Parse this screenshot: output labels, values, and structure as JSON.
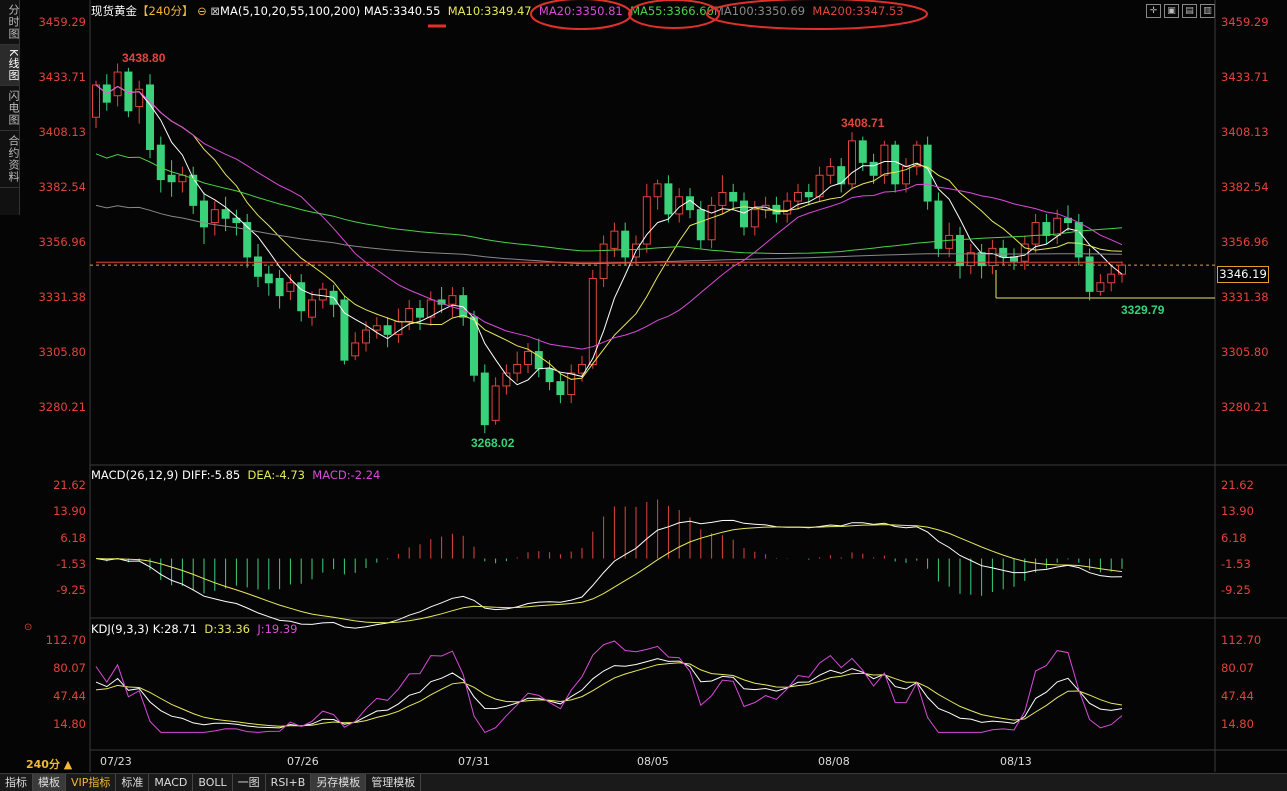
{
  "left_tabs": [
    "分时图",
    "K线图",
    "闪电图",
    "合约资料"
  ],
  "main": {
    "symbol": "现货黄金",
    "period_tag": "【240分】",
    "ma_params": "MA(5,10,20,55,100,200)",
    "ma5": "MA5:3340.55",
    "ma10": "MA10:3349.47",
    "ma20": "MA20:3350.81",
    "ma55": "MA55:3366.60",
    "ma100": "MA100:3350.69",
    "ma200": "MA200:3347.53",
    "price_ticks": [
      "3459.29",
      "3433.71",
      "3408.13",
      "3382.54",
      "3356.96",
      "3331.38",
      "3305.80",
      "3280.21"
    ],
    "current_price": "3346.19",
    "high_label": "3438.80",
    "mid_high_label": "3408.71",
    "low_label": "3268.02",
    "recent_low_label": "3329.79"
  },
  "macd": {
    "title": "MACD(26,12,9)",
    "diff": "DIFF:-5.85",
    "dea": "DEA:-4.73",
    "macd": "MACD:-2.24",
    "ticks": [
      "21.62",
      "13.90",
      "6.18",
      "-1.53",
      "-9.25"
    ]
  },
  "kdj": {
    "title": "KDJ(9,3,3)",
    "k": "K:28.71",
    "d": "D:33.36",
    "j": "J:19.39",
    "ticks": [
      "112.70",
      "80.07",
      "47.44",
      "14.80"
    ]
  },
  "dates": [
    "07/23",
    "07/26",
    "07/31",
    "08/05",
    "08/08",
    "08/13"
  ],
  "period_selector": "240分 ▲",
  "bottom_tabs": [
    "指标",
    "模板",
    "VIP指标",
    "标准",
    "MACD",
    "BOLL",
    "一图",
    "RSI+B",
    "另存模板",
    "管理模板"
  ],
  "colors": {
    "up": "#e0443c",
    "down": "#3ad17a",
    "ma5": "#ffffff",
    "ma10": "#e8e85a",
    "ma20": "#d94bd9",
    "ma55": "#4bd14b",
    "ma100": "#888888",
    "ma200": "#e0443c",
    "annotation": "#e0302a"
  },
  "chart_data": {
    "type": "candlestick",
    "price_ylim": [
      3260,
      3465
    ],
    "candles": [
      [
        3415,
        3430,
        3432,
        3410
      ],
      [
        3430,
        3422,
        3435,
        3418
      ],
      [
        3425,
        3436,
        3440,
        3420
      ],
      [
        3436,
        3418,
        3438,
        3415
      ],
      [
        3420,
        3428,
        3432,
        3412
      ],
      [
        3430,
        3400,
        3435,
        3396
      ],
      [
        3402,
        3386,
        3406,
        3380
      ],
      [
        3388,
        3385,
        3395,
        3378
      ],
      [
        3385,
        3388,
        3392,
        3380
      ],
      [
        3388,
        3374,
        3392,
        3370
      ],
      [
        3376,
        3364,
        3380,
        3356
      ],
      [
        3366,
        3372,
        3376,
        3360
      ],
      [
        3372,
        3368,
        3378,
        3362
      ],
      [
        3368,
        3366,
        3372,
        3360
      ],
      [
        3366,
        3350,
        3370,
        3345
      ],
      [
        3350,
        3341,
        3356,
        3336
      ],
      [
        3342,
        3338,
        3346,
        3332
      ],
      [
        3340,
        3332,
        3344,
        3326
      ],
      [
        3334,
        3338,
        3342,
        3330
      ],
      [
        3338,
        3325,
        3342,
        3320
      ],
      [
        3322,
        3330,
        3334,
        3318
      ],
      [
        3330,
        3335,
        3338,
        3326
      ],
      [
        3334,
        3328,
        3337,
        3322
      ],
      [
        3330,
        3302,
        3332,
        3300
      ],
      [
        3304,
        3310,
        3315,
        3302
      ],
      [
        3310,
        3316,
        3320,
        3306
      ],
      [
        3316,
        3318,
        3322,
        3312
      ],
      [
        3318,
        3314,
        3322,
        3308
      ],
      [
        3314,
        3320,
        3326,
        3310
      ],
      [
        3320,
        3326,
        3330,
        3316
      ],
      [
        3326,
        3322,
        3330,
        3316
      ],
      [
        3322,
        3330,
        3334,
        3318
      ],
      [
        3330,
        3328,
        3336,
        3324
      ],
      [
        3328,
        3332,
        3336,
        3322
      ],
      [
        3332,
        3322,
        3336,
        3318
      ],
      [
        3322,
        3295,
        3325,
        3292
      ],
      [
        3296,
        3272,
        3300,
        3268
      ],
      [
        3274,
        3290,
        3294,
        3272
      ],
      [
        3290,
        3296,
        3300,
        3286
      ],
      [
        3296,
        3300,
        3306,
        3292
      ],
      [
        3300,
        3306,
        3310,
        3296
      ],
      [
        3306,
        3298,
        3312,
        3294
      ],
      [
        3298,
        3292,
        3302,
        3288
      ],
      [
        3292,
        3286,
        3296,
        3282
      ],
      [
        3286,
        3296,
        3300,
        3282
      ],
      [
        3296,
        3300,
        3304,
        3292
      ],
      [
        3300,
        3340,
        3344,
        3298
      ],
      [
        3340,
        3356,
        3360,
        3336
      ],
      [
        3354,
        3362,
        3366,
        3350
      ],
      [
        3362,
        3350,
        3366,
        3346
      ],
      [
        3350,
        3356,
        3360,
        3346
      ],
      [
        3356,
        3378,
        3384,
        3352
      ],
      [
        3378,
        3384,
        3386,
        3372
      ],
      [
        3384,
        3370,
        3388,
        3366
      ],
      [
        3370,
        3378,
        3382,
        3366
      ],
      [
        3378,
        3372,
        3382,
        3368
      ],
      [
        3372,
        3358,
        3376,
        3354
      ],
      [
        3358,
        3374,
        3378,
        3354
      ],
      [
        3374,
        3380,
        3388,
        3370
      ],
      [
        3380,
        3376,
        3384,
        3372
      ],
      [
        3376,
        3364,
        3380,
        3360
      ],
      [
        3364,
        3372,
        3376,
        3360
      ],
      [
        3372,
        3374,
        3378,
        3368
      ],
      [
        3374,
        3370,
        3378,
        3366
      ],
      [
        3370,
        3376,
        3380,
        3366
      ],
      [
        3376,
        3380,
        3384,
        3372
      ],
      [
        3380,
        3378,
        3384,
        3374
      ],
      [
        3378,
        3388,
        3392,
        3376
      ],
      [
        3388,
        3392,
        3396,
        3384
      ],
      [
        3392,
        3384,
        3396,
        3380
      ],
      [
        3384,
        3404,
        3408,
        3382
      ],
      [
        3404,
        3394,
        3406,
        3390
      ],
      [
        3394,
        3388,
        3398,
        3384
      ],
      [
        3388,
        3402,
        3404,
        3384
      ],
      [
        3402,
        3384,
        3404,
        3380
      ],
      [
        3384,
        3392,
        3396,
        3380
      ],
      [
        3392,
        3402,
        3404,
        3388
      ],
      [
        3402,
        3376,
        3406,
        3372
      ],
      [
        3376,
        3354,
        3380,
        3350
      ],
      [
        3354,
        3360,
        3366,
        3350
      ],
      [
        3360,
        3346,
        3364,
        3340
      ],
      [
        3346,
        3352,
        3356,
        3342
      ],
      [
        3352,
        3346,
        3356,
        3340
      ],
      [
        3346,
        3354,
        3358,
        3342
      ],
      [
        3354,
        3350,
        3358,
        3346
      ],
      [
        3350,
        3348,
        3354,
        3344
      ],
      [
        3348,
        3356,
        3360,
        3344
      ],
      [
        3356,
        3366,
        3370,
        3352
      ],
      [
        3366,
        3360,
        3370,
        3356
      ],
      [
        3360,
        3368,
        3372,
        3356
      ],
      [
        3368,
        3366,
        3374,
        3362
      ],
      [
        3366,
        3350,
        3370,
        3346
      ],
      [
        3350,
        3334,
        3354,
        3329.79
      ],
      [
        3334,
        3338,
        3342,
        3332
      ],
      [
        3338,
        3342,
        3346,
        3334
      ],
      [
        3342,
        3346.19,
        3348,
        3338
      ]
    ]
  }
}
